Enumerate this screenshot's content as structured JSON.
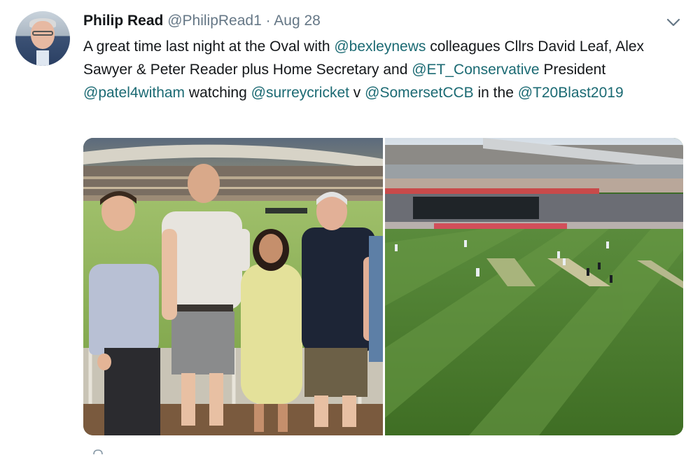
{
  "tweet": {
    "name": "Philip Read",
    "handle": "@PhilipRead1",
    "separator": "·",
    "date": "Aug 28",
    "text_segments": [
      {
        "text": "A great time last night at the Oval with ",
        "type": "text"
      },
      {
        "text": "@bexleynews",
        "type": "mention"
      },
      {
        "text": " colleagues Cllrs David Leaf, Alex Sawyer & Peter Reader plus Home Secretary and ",
        "type": "text"
      },
      {
        "text": "@ET_Conservative",
        "type": "mention"
      },
      {
        "text": " President ",
        "type": "text"
      },
      {
        "text": "@patel4witham",
        "type": "mention"
      },
      {
        "text": " watching ",
        "type": "text"
      },
      {
        "text": "@surreycricket",
        "type": "mention"
      },
      {
        "text": " v ",
        "type": "text"
      },
      {
        "text": "@SomersetCCB",
        "type": "mention"
      },
      {
        "text": " in the ",
        "type": "text"
      },
      {
        "text": "@T20Blast2019",
        "type": "mention"
      }
    ],
    "icons": {
      "avatar": "profile-photo",
      "menu": "chevron-down-icon"
    },
    "colors": {
      "link": "#1b6a73",
      "text": "#14171a",
      "muted": "#657786"
    }
  }
}
